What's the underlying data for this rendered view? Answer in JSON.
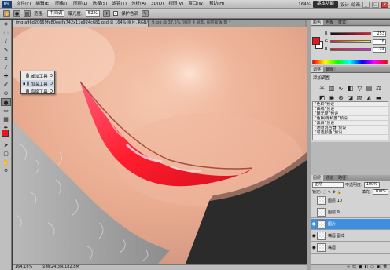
{
  "menubar": {
    "logo": "Ps",
    "menus": [
      "文件(F)",
      "编辑(E)",
      "图像(I)",
      "图层(L)",
      "选择(S)",
      "滤镜(T)",
      "分析(A)",
      "3D(D)",
      "视图(V)",
      "窗口(W)",
      "帮助(H)"
    ],
    "zoom": "164%",
    "workspace": "基本功能",
    "design": "设计",
    "paint": "绘画",
    "win_min": "_",
    "win_max": "□",
    "win_close": "x"
  },
  "options": {
    "range_label": "范围:",
    "range_value": "中间调",
    "exposure_label": "曝光度:",
    "exposure_value": "52%",
    "protect_label": "保护色调",
    "protect_checked": true
  },
  "toolbox": {
    "tools": [
      "move",
      "marquee",
      "lasso",
      "quick-select",
      "crop",
      "eyedropper",
      "healing",
      "brush",
      "clone",
      "history",
      "eraser",
      "gradient",
      "dodge",
      "pen",
      "type",
      "path",
      "shape",
      "3d",
      "hand",
      "zoom"
    ],
    "fg_color": "#e7171e",
    "bg_color": "#ffffff"
  },
  "flyout": {
    "items": [
      {
        "label": "减淡工具",
        "key": "O",
        "selected": false
      },
      {
        "label": "加深工具",
        "key": "O",
        "selected": true
      },
      {
        "label": "海绵工具",
        "key": "O",
        "selected": false
      }
    ]
  },
  "document": {
    "tab1": "img-a96d20669fe80ee|fa742x11e924c681.psd @ 164%(图片, RGB/8) *",
    "tab2": "9.jpg @ 37.5% (图层 4 副本, 图层蒙版/8) *"
  },
  "status": {
    "zoom": "164.16%",
    "doc": "文档:24.3M/182.8M"
  },
  "color_panel": {
    "tabs": [
      "颜色",
      "色板",
      "样式"
    ],
    "r": "253",
    "g": "16",
    "b": "33"
  },
  "adjustments": {
    "tabs": [
      "调整",
      "蒙版"
    ],
    "title": "添加调整",
    "presets": [
      "“色阶”预设",
      "“曲线”预设",
      "“曝光度”预设",
      "“色相/饱和度”预设",
      "“黑白”预设",
      "“通道混合器”预设",
      "“可选颜色”预设"
    ]
  },
  "layers": {
    "tabs": [
      "图层",
      "通道",
      "路径"
    ],
    "blend_mode": "正常",
    "opacity_label": "不透明度:",
    "opacity": "100%",
    "lock_label": "锁定:",
    "fill_label": "填充:",
    "fill": "100%",
    "items": [
      {
        "name": "图层 10",
        "visible": false,
        "selected": false
      },
      {
        "name": "图层 9",
        "visible": false,
        "selected": false
      },
      {
        "name": "图片",
        "visible": true,
        "selected": true
      },
      {
        "name": "嘴唇 副本",
        "visible": true,
        "selected": false
      },
      {
        "name": "嘴唇",
        "visible": true,
        "selected": false
      }
    ]
  }
}
